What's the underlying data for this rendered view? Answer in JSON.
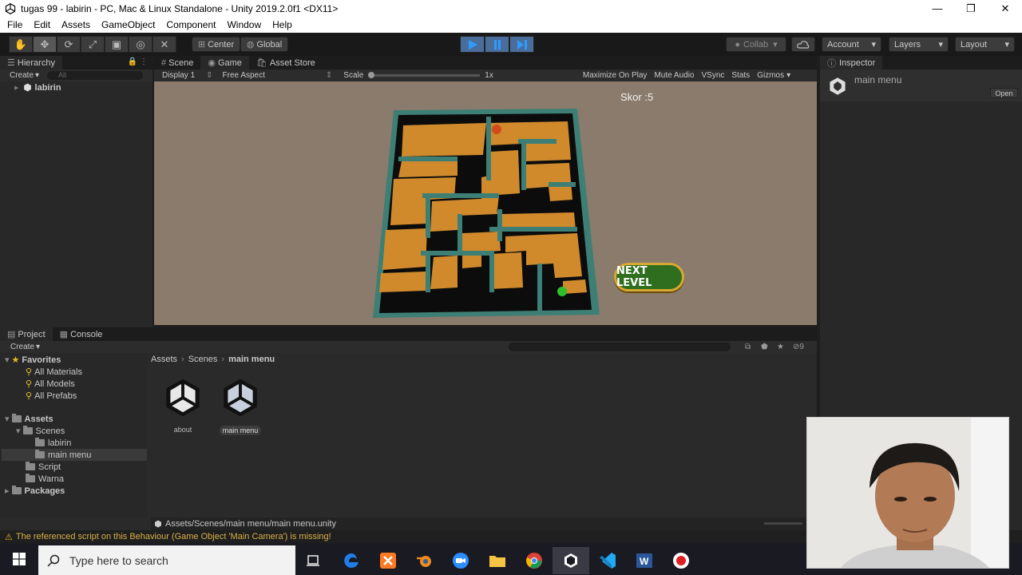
{
  "window": {
    "title": "tugas 99 - labirin - PC, Mac & Linux Standalone - Unity 2019.2.0f1 <DX11>",
    "minimize": "—",
    "maximize": "❐",
    "close": "✕"
  },
  "menu": [
    "File",
    "Edit",
    "Assets",
    "GameObject",
    "Component",
    "Window",
    "Help"
  ],
  "toolbar": {
    "pivot": "Center",
    "space": "Global",
    "collab": "Collab",
    "account": "Account",
    "layers": "Layers",
    "layout": "Layout",
    "play_color": "#4a6d9c"
  },
  "hierarchy": {
    "tab": "Hierarchy",
    "create": "Create",
    "search_placeholder": "All",
    "scene": "labirin"
  },
  "center": {
    "tabs": [
      "Scene",
      "Game",
      "Asset Store"
    ],
    "display": "Display 1",
    "aspect": "Free Aspect",
    "scale_label": "Scale",
    "scale_value": "1x",
    "options": [
      "Maximize On Play",
      "Mute Audio",
      "VSync",
      "Stats",
      "Gizmos"
    ]
  },
  "game": {
    "score": "Skor :5",
    "next_level": "NEXT LEVEL",
    "bg_color": "#8b7b6c",
    "floor_color": "#d08a2c",
    "wall_color": "#3e7f75"
  },
  "inspector": {
    "tab": "Inspector",
    "name": "main menu",
    "open": "Open"
  },
  "project": {
    "tabs": [
      "Project",
      "Console"
    ],
    "create": "Create",
    "favorites_label": "Favorites",
    "favorites": [
      "All Materials",
      "All Models",
      "All Prefabs"
    ],
    "assets_label": "Assets",
    "scenes_label": "Scenes",
    "scene_folders": [
      "labirin",
      "main menu"
    ],
    "other_folders": [
      "Script",
      "Warna"
    ],
    "packages_label": "Packages",
    "breadcrumb": [
      "Assets",
      "Scenes",
      "main menu"
    ],
    "files": [
      "about",
      "main menu"
    ],
    "path": "Assets/Scenes/main menu/main menu.unity",
    "hidden_count": "9"
  },
  "status": {
    "message": "The referenced script on this Behaviour (Game Object 'Main Camera') is missing!"
  },
  "taskbar": {
    "search_placeholder": "Type here to search"
  }
}
